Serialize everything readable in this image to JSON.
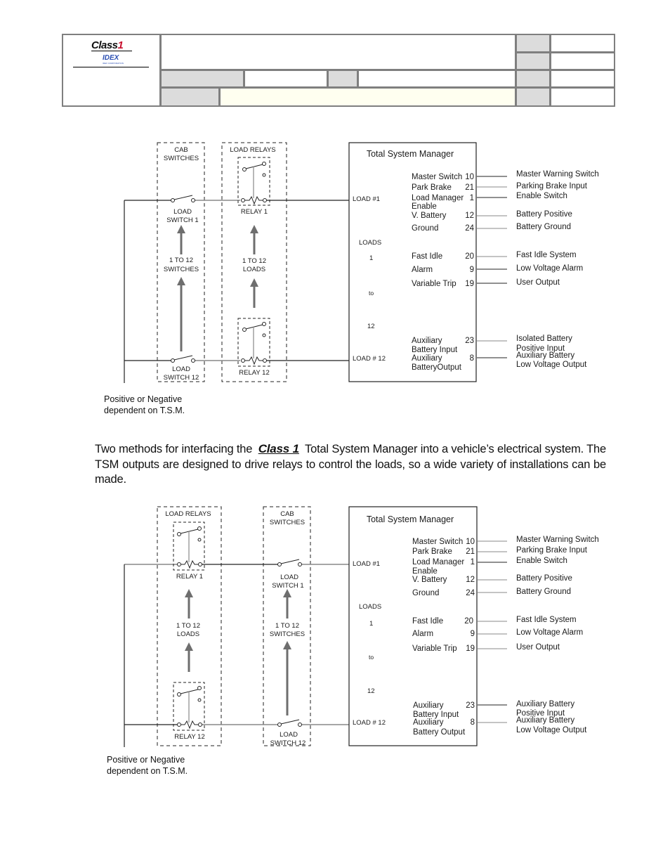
{
  "header": {
    "brand": "Class",
    "brand_number": "1",
    "sub_brand": "IDEX",
    "sub_brand_caption": "IDEX CORPORATION",
    "colors": {
      "border": "#7f7f7f",
      "gray_cell": "#dcdcdc",
      "yellow_cell": "#fffff0",
      "brand_red": "#c8102e",
      "idex_blue": "#2b4fb3"
    }
  },
  "paragraph": {
    "before": "Two methods for interfacing the",
    "brand": "Class 1",
    "after": "Total System Manager into a vehicle’s electrical system.  The TSM outputs are designed to drive relays to control the loads, so a wide variety of installations can be made."
  },
  "diagram1": {
    "cab_box": {
      "title1": "CAB",
      "title2": "SWITCHES",
      "switch_top1": "LOAD",
      "switch_top2": "SWITCH 1",
      "range1": "1 TO 12",
      "range2": "SWITCHES",
      "switch_bot1": "LOAD",
      "switch_bot2": "SWITCH 12"
    },
    "relay_box": {
      "title": "LOAD RELAYS",
      "relay_top": "RELAY 1",
      "range1": "1 TO 12",
      "range2": "LOADS",
      "relay_bot": "RELAY 12"
    },
    "tsm": {
      "title": "Total System Manager",
      "load_top": "LOAD #1",
      "loads_label": "LOADS",
      "loads_from": "1",
      "loads_to_word": "to",
      "loads_to": "12",
      "load_bot": "LOAD # 12",
      "pins": [
        {
          "name": "Master Switch",
          "num": "10",
          "output": "Master Warning Switch"
        },
        {
          "name": "Park Brake",
          "num": "21",
          "output": "Parking Brake Input"
        },
        {
          "name": "Load Manager",
          "name2": "Enable",
          "num": "1",
          "output": "Enable Switch"
        },
        {
          "name": "V. Battery",
          "num": "12",
          "output": "Battery Positive"
        },
        {
          "name": "Ground",
          "num": "24",
          "output": "Battery Ground"
        },
        {
          "name": "Fast Idle",
          "num": "20",
          "output": "Fast Idle System"
        },
        {
          "name": "Alarm",
          "num": "9",
          "output": "Low Voltage Alarm"
        },
        {
          "name": "Variable Trip",
          "num": "19",
          "output": "User Output"
        },
        {
          "name": "Auxiliary",
          "name2": "Battery Input",
          "num": "23",
          "output": "Isolated Battery",
          "output2": "Positive Input"
        },
        {
          "name": "Auxiliary",
          "name2": "BatteryOutput",
          "num": "8",
          "output": "Auxiliary Battery",
          "output2": "Low Voltage Output"
        }
      ]
    },
    "note1": "Positive or Negative",
    "note2": "dependent on T.S.M."
  },
  "diagram2": {
    "relay_box": {
      "title": "LOAD RELAYS",
      "relay_top": "RELAY 1",
      "range1": "1 TO 12",
      "range2": "LOADS",
      "relay_bot": "RELAY 12"
    },
    "cab_box": {
      "title1": "CAB",
      "title2": "SWITCHES",
      "switch_top1": "LOAD",
      "switch_top2": "SWITCH 1",
      "range1": "1 TO 12",
      "range2": "SWITCHES",
      "switch_bot1": "LOAD",
      "switch_bot2": "SWITCH 12"
    },
    "tsm": {
      "title": "Total System Manager",
      "load_top": "LOAD #1",
      "loads_label": "LOADS",
      "loads_from": "1",
      "loads_to_word": "to",
      "loads_to": "12",
      "load_bot": "LOAD # 12",
      "pins": [
        {
          "name": "Master Switch",
          "num": "10",
          "output": "Master Warning Switch"
        },
        {
          "name": "Park Brake",
          "num": "21",
          "output": "Parking Brake Input"
        },
        {
          "name": "Load Manager",
          "name2": "Enable",
          "num": "1",
          "output": "Enable Switch"
        },
        {
          "name": "V. Battery",
          "num": "12",
          "output": "Battery Positive"
        },
        {
          "name": "Ground",
          "num": "24",
          "output": "Battery Ground"
        },
        {
          "name": "Fast Idle",
          "num": "20",
          "output": "Fast Idle System"
        },
        {
          "name": "Alarm",
          "num": "9",
          "output": "Low Voltage Alarm"
        },
        {
          "name": "Variable Trip",
          "num": "19",
          "output": "User Output"
        },
        {
          "name": "Auxiliary",
          "name2": "Battery Input",
          "num": "23",
          "output": "Auxiliary Battery",
          "output2": "Positive Input"
        },
        {
          "name": "Auxiliary",
          "name2": "Battery Output",
          "num": "8",
          "output": "Auxiliary Battery",
          "output2": "Low Voltage Output"
        }
      ]
    },
    "note1": "Positive or Negative",
    "note2": "dependent on T.S.M."
  }
}
